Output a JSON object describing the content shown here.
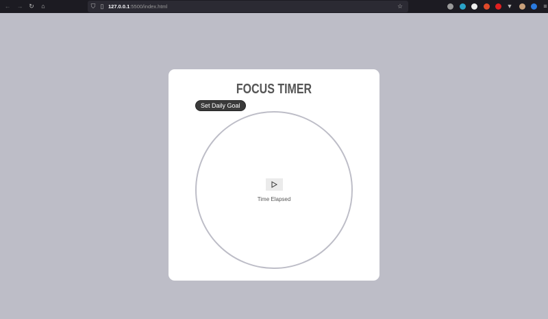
{
  "browser": {
    "url_host": "127.0.0.1",
    "url_rest": ":5500/index.html"
  },
  "app": {
    "title": "FOCUS TIMER",
    "goal_button": "Set Daily Goal",
    "status": "Time Elapsed"
  },
  "colors": {
    "background": "#bdbdc7",
    "card": "#ffffff",
    "ring": "#bdbdc7"
  }
}
